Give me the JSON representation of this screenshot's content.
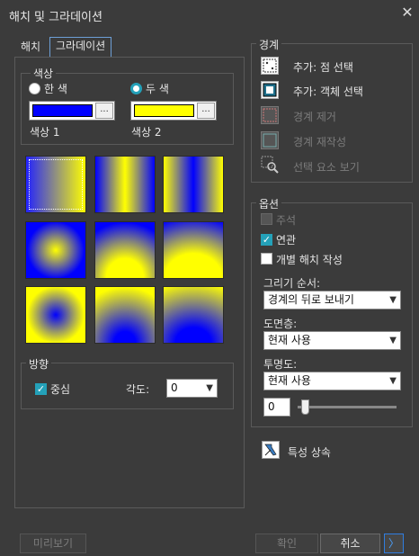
{
  "window": {
    "title": "해치 및 그라데이션",
    "close_glyph": "✕"
  },
  "tabs": [
    {
      "label": "해치"
    },
    {
      "label": "그라데이션"
    }
  ],
  "color_group": {
    "title": "색상",
    "one_color": {
      "label": "한 색"
    },
    "two_color": {
      "label": "두 색"
    },
    "color1": {
      "label": "색상 1",
      "value": "#0000ff",
      "browse": "..."
    },
    "color2": {
      "label": "색상 2",
      "value": "#ffff00",
      "browse": "..."
    }
  },
  "patterns": [
    {
      "id": "linear-h",
      "selected": true
    },
    {
      "id": "cylinder-h",
      "selected": false
    },
    {
      "id": "inv-cylinder-h",
      "selected": false
    },
    {
      "id": "spherical",
      "selected": false
    },
    {
      "id": "hemispherical",
      "selected": false
    },
    {
      "id": "curved",
      "selected": false
    },
    {
      "id": "inv-spherical",
      "selected": false
    },
    {
      "id": "inv-hemispherical",
      "selected": false
    },
    {
      "id": "inv-curved",
      "selected": false
    }
  ],
  "orientation": {
    "title": "방향",
    "centered": {
      "label": "중심",
      "checked": true
    },
    "angle": {
      "label": "각도:",
      "value": "0"
    }
  },
  "boundaries": {
    "title": "경계",
    "items": [
      {
        "label": "추가: 점 선택",
        "enabled": true,
        "icon": "pick-points-icon"
      },
      {
        "label": "추가: 객체 선택",
        "enabled": true,
        "icon": "select-objects-icon"
      },
      {
        "label": "경계 제거",
        "enabled": false,
        "icon": "remove-boundary-icon"
      },
      {
        "label": "경계 재작성",
        "enabled": false,
        "icon": "recreate-boundary-icon"
      },
      {
        "label": "선택 요소 보기",
        "enabled": false,
        "icon": "view-selections-icon"
      }
    ]
  },
  "options": {
    "title": "옵션",
    "annotative": {
      "label": "주석",
      "checked": false,
      "enabled": false
    },
    "associative": {
      "label": "연관",
      "checked": true,
      "enabled": true
    },
    "separate": {
      "label": "개별 해치 작성",
      "checked": false,
      "enabled": true
    },
    "draw_order": {
      "label": "그리기 순서:",
      "value": "경계의 뒤로 보내기"
    },
    "layer": {
      "label": "도면층:",
      "value": "현재 사용"
    },
    "transparency": {
      "label": "투명도:",
      "value": "현재 사용",
      "amount": "0"
    }
  },
  "inherit": {
    "label": "특성 상속"
  },
  "footer": {
    "preview": "미리보기",
    "ok": "확인",
    "cancel": "취소",
    "expand": "〉"
  }
}
